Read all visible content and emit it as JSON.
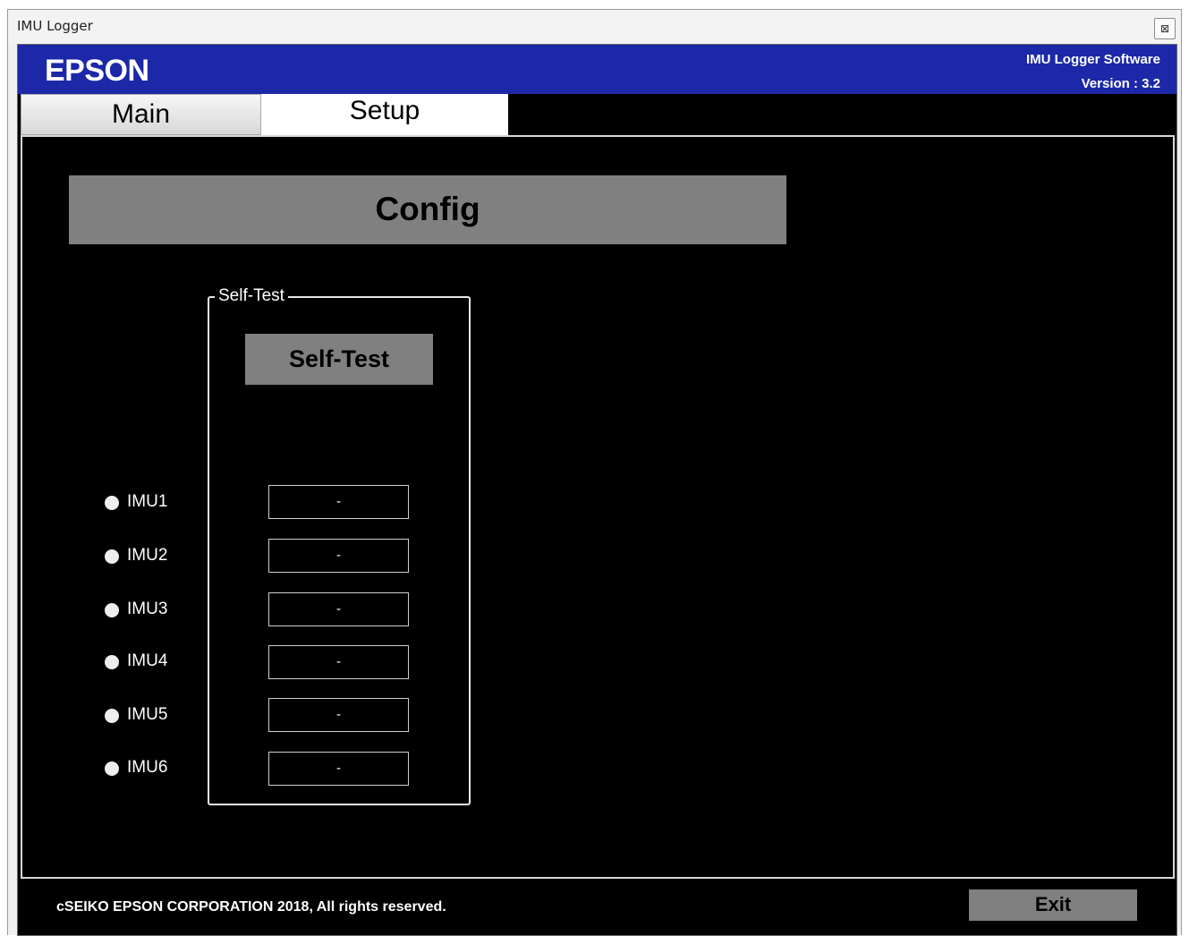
{
  "window": {
    "title": "IMU Logger",
    "close_glyph": "⊠"
  },
  "header": {
    "logo": "EPSON",
    "software_name": "IMU Logger Software",
    "version": "Version : 3.2",
    "background_color": "#1c28a8"
  },
  "tabs": [
    {
      "label": "Main",
      "active": false
    },
    {
      "label": "Setup",
      "active": true
    }
  ],
  "config": {
    "banner_label": "Config"
  },
  "selftest": {
    "group_label": "Self-Test",
    "button_label": "Self-Test",
    "imus": [
      {
        "label": "IMU1",
        "result": "-",
        "indicator_color": "#eeeeee"
      },
      {
        "label": "IMU2",
        "result": "-",
        "indicator_color": "#eeeeee"
      },
      {
        "label": "IMU3",
        "result": "-",
        "indicator_color": "#eeeeee"
      },
      {
        "label": "IMU4",
        "result": "-",
        "indicator_color": "#eeeeee"
      },
      {
        "label": "IMU5",
        "result": "-",
        "indicator_color": "#eeeeee"
      },
      {
        "label": "IMU6",
        "result": "-",
        "indicator_color": "#eeeeee"
      }
    ]
  },
  "footer": {
    "copyright": "cSEIKO EPSON CORPORATION 2018, All rights reserved.",
    "exit_label": "Exit"
  }
}
